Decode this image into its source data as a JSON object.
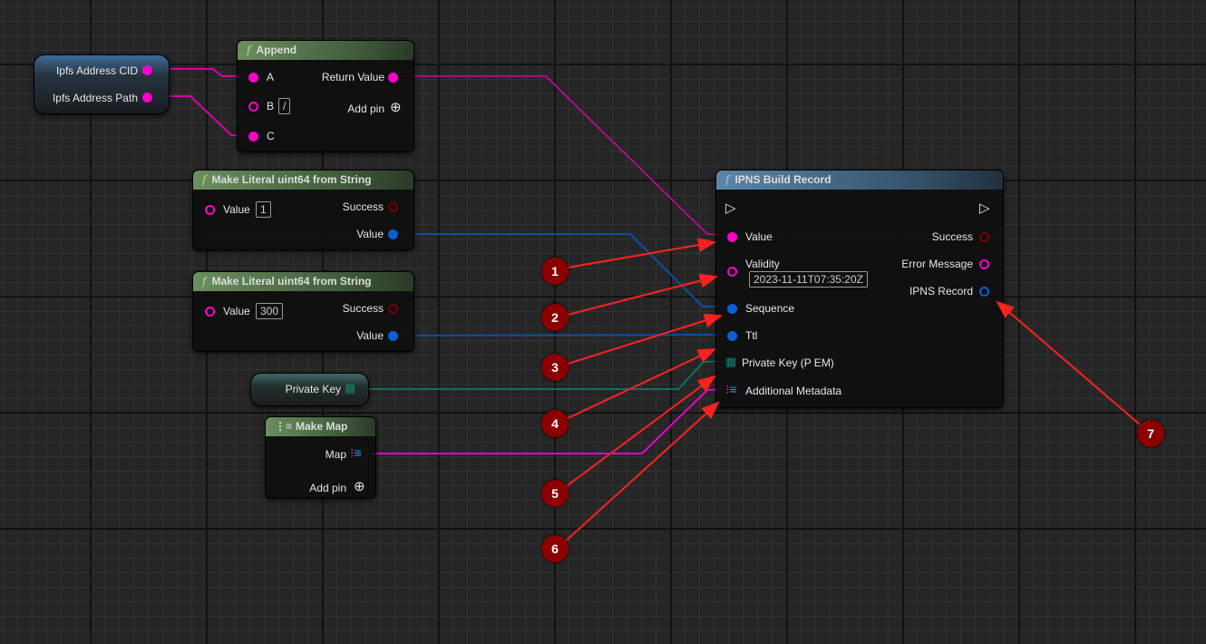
{
  "colors": {
    "string_pin": "#ff00cc",
    "int64_pin": "#0a5fd6",
    "bool_pin": "#770000",
    "struct_pin": "#14806e",
    "callout": "#8b0000",
    "arrow": "#ff2020"
  },
  "var_node_ipfs": {
    "cid": "Ipfs Address CID",
    "path": "Ipfs Address Path"
  },
  "append": {
    "title": "Append",
    "a": "A",
    "b": "B",
    "b_value": "/",
    "c": "C",
    "return": "Return Value",
    "add_pin": "Add pin"
  },
  "literal1": {
    "title": "Make Literal uint64 from String",
    "value_label": "Value",
    "value": "1",
    "success": "Success",
    "out": "Value"
  },
  "literal2": {
    "title": "Make Literal uint64 from String",
    "value_label": "Value",
    "value": "300",
    "success": "Success",
    "out": "Value"
  },
  "private_key_var": {
    "label": "Private Key"
  },
  "make_map": {
    "title": "Make Map",
    "map": "Map",
    "add_pin": "Add pin"
  },
  "ipns": {
    "title": "IPNS Build Record",
    "value": "Value",
    "validity": "Validity",
    "validity_value": "2023-11-11T07:35:20Z",
    "sequence": "Sequence",
    "ttl": "Ttl",
    "private_key": "Private Key (P EM)",
    "metadata": "Additional Metadata",
    "success": "Success",
    "error": "Error Message",
    "record": "IPNS Record"
  },
  "callouts": [
    "1",
    "2",
    "3",
    "4",
    "5",
    "6",
    "7"
  ]
}
